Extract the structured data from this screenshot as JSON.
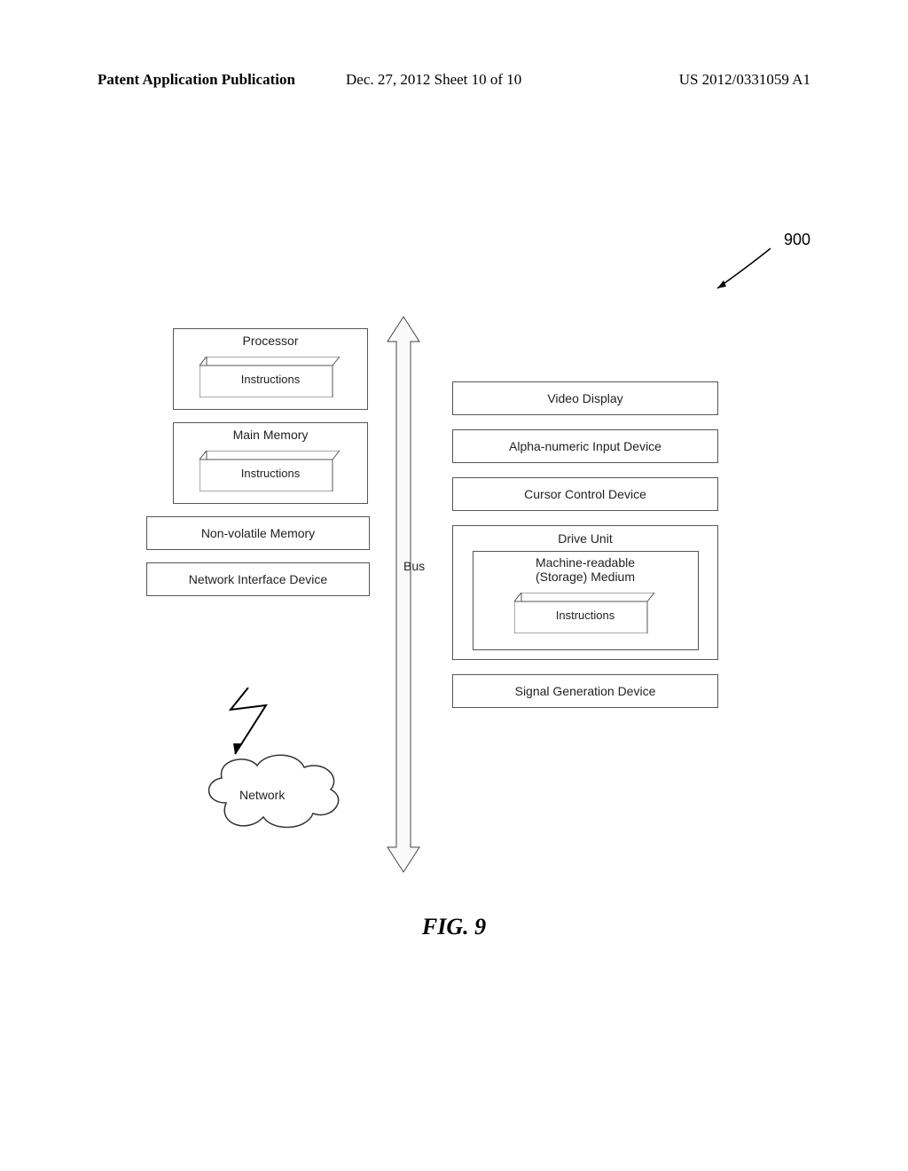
{
  "header": {
    "left": "Patent Application Publication",
    "mid": "Dec. 27, 2012  Sheet 10 of 10",
    "right": "US 2012/0331059 A1"
  },
  "ref_num": "900",
  "bus_label": "Bus",
  "left": {
    "processor": {
      "title": "Processor",
      "instr": "Instructions"
    },
    "main_memory": {
      "title": "Main Memory",
      "instr": "Instructions"
    },
    "nv_memory": "Non-volatile Memory",
    "nid": "Network Interface Device"
  },
  "right": {
    "video": "Video Display",
    "alpha": "Alpha-numeric Input Device",
    "cursor": "Cursor Control Device",
    "drive": {
      "title": "Drive Unit",
      "medium_line1": "Machine-readable",
      "medium_line2": "(Storage) Medium",
      "instr": "Instructions"
    },
    "signal": "Signal Generation Device"
  },
  "network": "Network",
  "fig_caption": "FIG. 9"
}
